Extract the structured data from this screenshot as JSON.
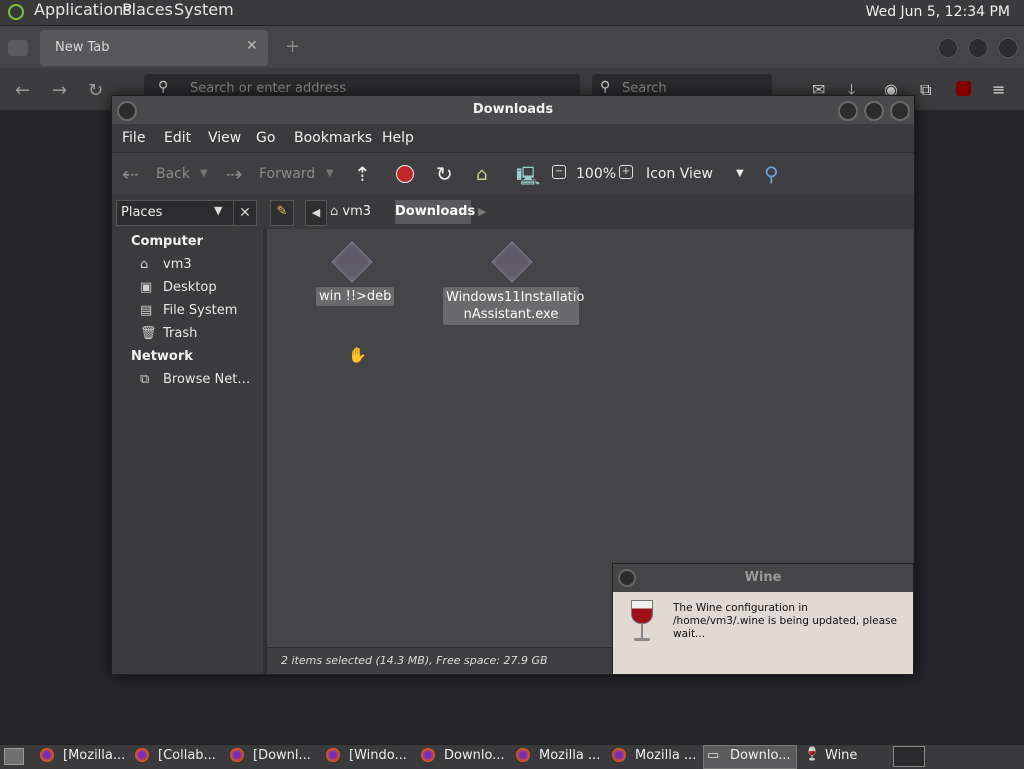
{
  "top_panel": {
    "menus": [
      "Applications",
      "Places",
      "System"
    ],
    "clock": "Wed Jun  5, 12:34 PM"
  },
  "browser": {
    "tab_title": "New Tab",
    "address_placeholder": "Search or enter address",
    "search_placeholder": "Search"
  },
  "file_manager": {
    "title": "Downloads",
    "menus": [
      "File",
      "Edit",
      "View",
      "Go",
      "Bookmarks",
      "Help"
    ],
    "toolbar": {
      "back": "Back",
      "forward": "Forward",
      "zoom": "100%",
      "view_mode": "Icon View"
    },
    "sidebar_combo": "Places",
    "breadcrumb": [
      "vm3",
      "Downloads"
    ],
    "sidebar": {
      "computer_header": "Computer",
      "computer_items": [
        "vm3",
        "Desktop",
        "File System",
        "Trash"
      ],
      "network_header": "Network",
      "network_items": [
        "Browse Net…"
      ]
    },
    "files": [
      {
        "name": "win !!>deb"
      },
      {
        "name": "Windows11InstallationAssistant.exe",
        "line1": "Windows11Installatio",
        "line2": "nAssistant.exe"
      }
    ],
    "status": "2 items selected (14.3 MB), Free space: 27.9 GB"
  },
  "wine_dialog": {
    "title": "Wine",
    "message": "The Wine configuration in /home/vm3/.wine is being updated, please wait..."
  },
  "taskbar": {
    "tasks": [
      "[Mozilla...",
      "[Collab...",
      "[Downl...",
      "[Windo...",
      "Downlo...",
      "Mozilla ...",
      "Mozilla ...",
      "Downlo...",
      "Wine"
    ]
  }
}
